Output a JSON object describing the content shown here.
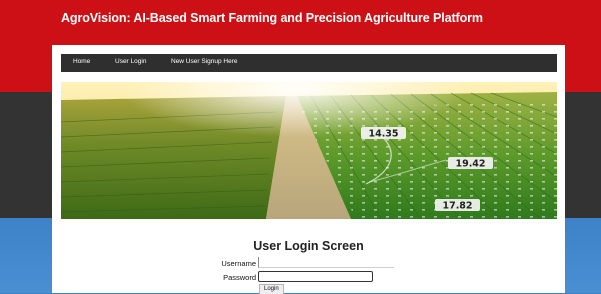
{
  "site": {
    "title": "AgroVision: AI-Based Smart Farming and Precision Agriculture Platform"
  },
  "nav": {
    "items": [
      {
        "label": "Home"
      },
      {
        "label": "User Login"
      },
      {
        "label": "New User Signup Here"
      }
    ]
  },
  "hero": {
    "readings": [
      "14.35",
      "19.42",
      "17.82"
    ]
  },
  "login": {
    "heading": "User Login Screen",
    "username_label": "Username",
    "password_label": "Password",
    "username_value": "",
    "password_value": "",
    "button_label": "Login"
  },
  "colors": {
    "header_red": "#cc1016",
    "band_dark": "#333333",
    "band_blue": "#3d82c8",
    "navbar": "#2f2f2f"
  }
}
